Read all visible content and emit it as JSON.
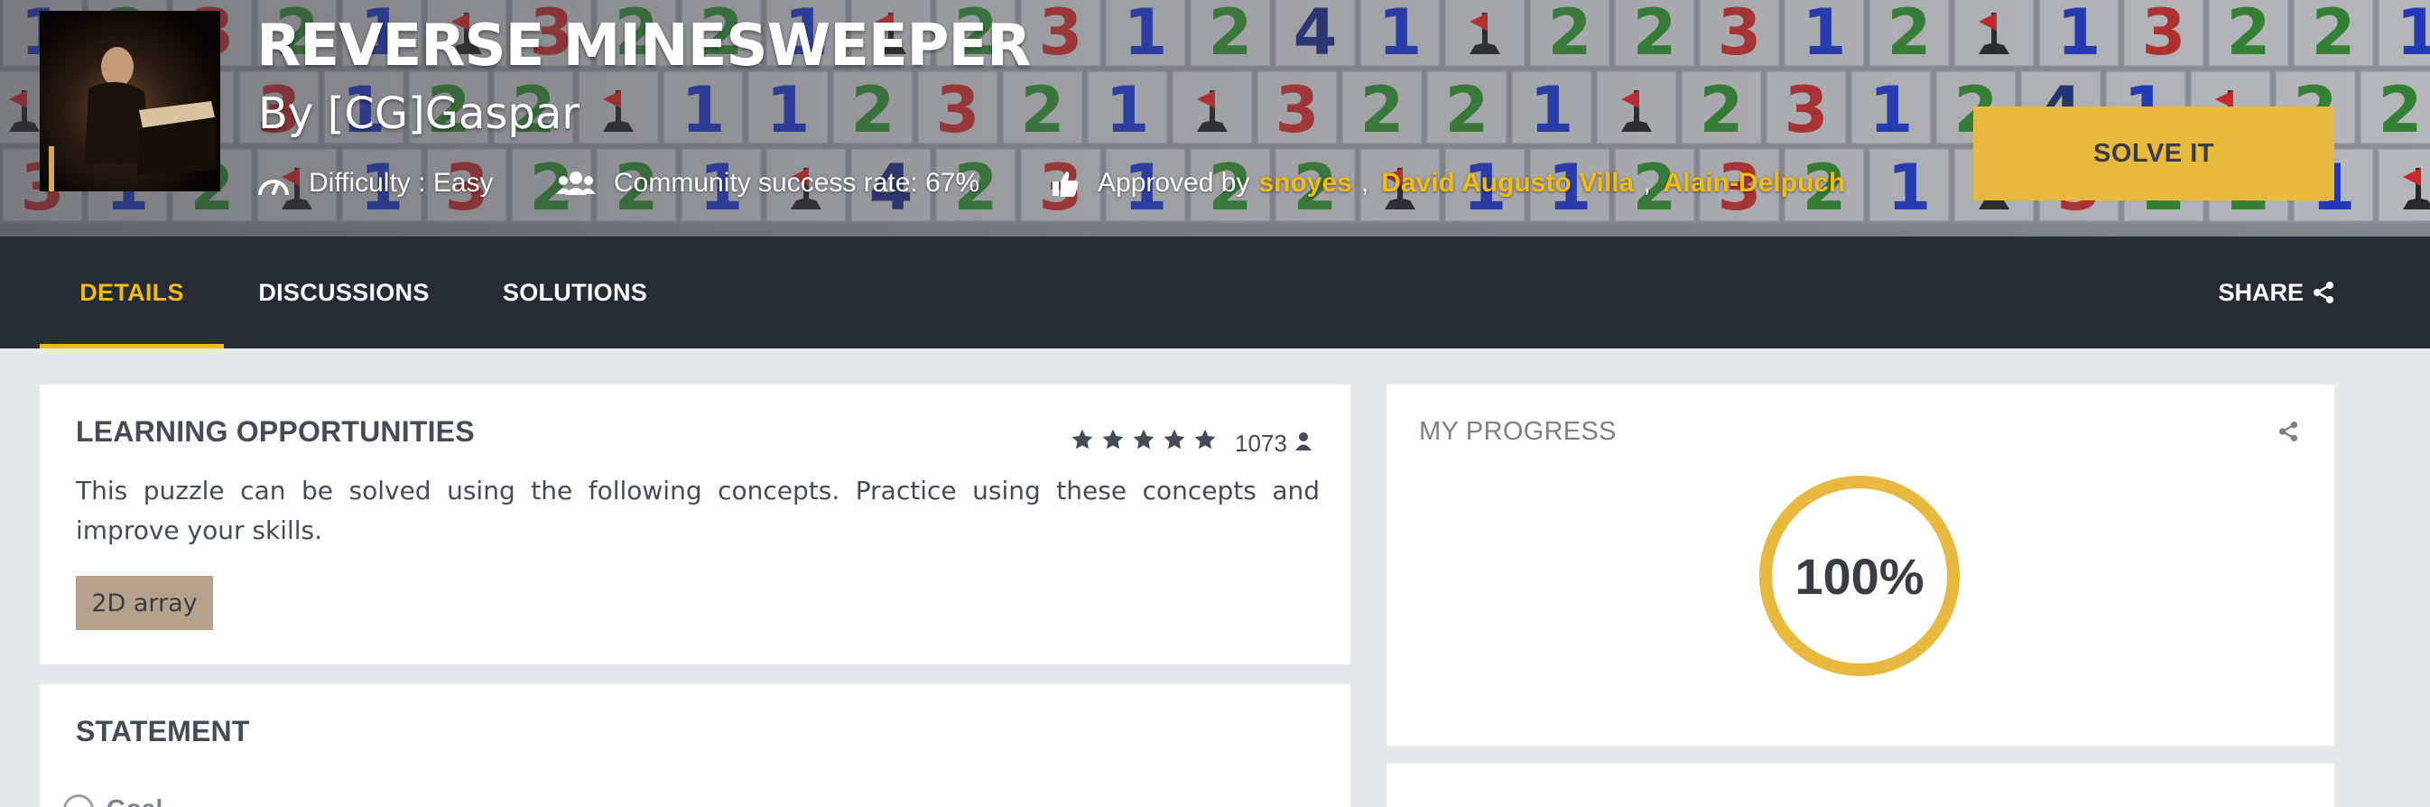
{
  "puzzle": {
    "title": "REVERSE MINESWEEPER",
    "author": "By [CG]Gaspar",
    "difficulty": "Difficulty : Easy",
    "success_rate": "Community success rate: 67%",
    "approved_label": "Approved by",
    "approvers": [
      "snoyes",
      "David Augusto Villa",
      "Alain-Delpuch"
    ]
  },
  "solve_button": "SOLVE IT",
  "tabs": [
    "DETAILS",
    "DISCUSSIONS",
    "SOLUTIONS"
  ],
  "active_tab": "DETAILS",
  "share_label": "SHARE",
  "learning": {
    "title": "LEARNING OPPORTUNITIES",
    "stars": 5,
    "rating_count": "1073",
    "description": "This puzzle can be solved using the following concepts. Practice using these concepts and improve your skills.",
    "tags": [
      "2D array"
    ]
  },
  "progress": {
    "title": "MY PROGRESS",
    "value_label": "100%",
    "fraction": 1.0
  },
  "statement": {
    "title": "STATEMENT",
    "first_item": "Goal"
  },
  "colors": {
    "accent": "#f2bb13",
    "solve_button": "#e7b93e",
    "nav_bg": "#272b35",
    "tag_bg": "#b4a28d",
    "ring": "#e7b93e"
  },
  "icons": {
    "difficulty": "gauge-icon",
    "community": "users-icon",
    "approved": "thumbs-up-icon",
    "share": "share-icon",
    "rating_user": "user-icon"
  }
}
